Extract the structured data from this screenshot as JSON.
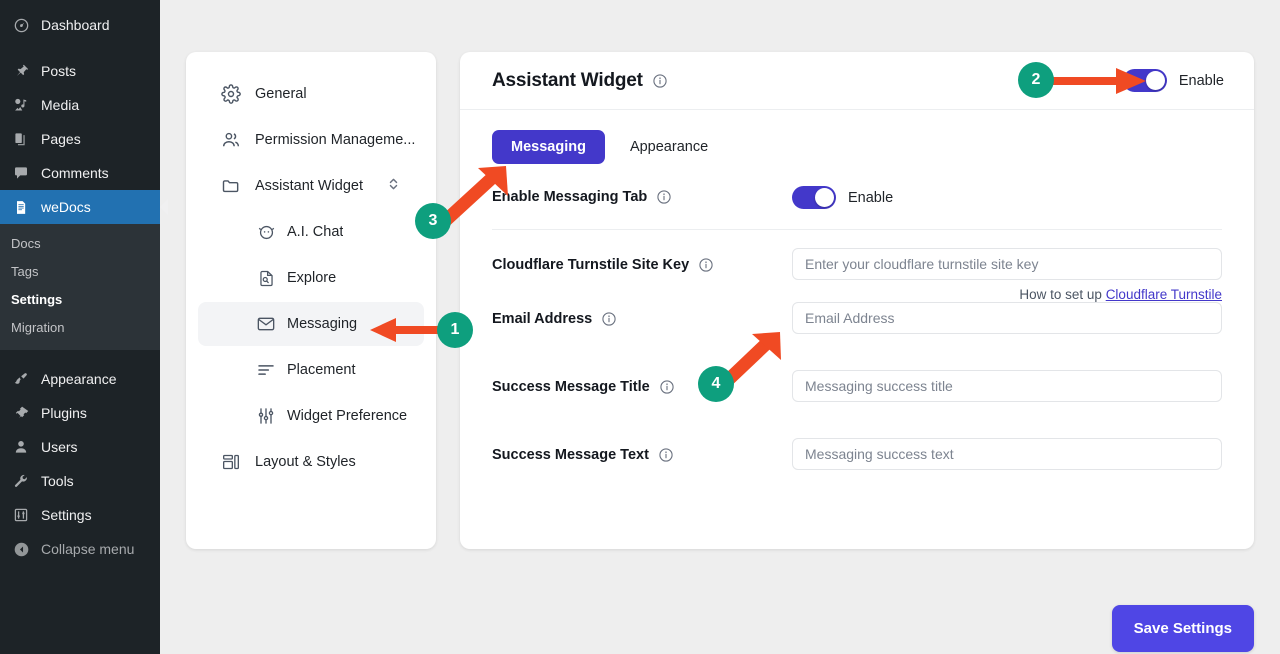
{
  "wp_admin": {
    "items": [
      {
        "label": "Dashboard",
        "icon": "dashboard-icon"
      },
      {
        "label": "Posts",
        "icon": "pin-icon"
      },
      {
        "label": "Media",
        "icon": "media-icon"
      },
      {
        "label": "Pages",
        "icon": "pages-icon"
      },
      {
        "label": "Comments",
        "icon": "comments-icon"
      },
      {
        "label": "weDocs",
        "icon": "document-icon",
        "active": true
      }
    ],
    "submenu": [
      {
        "label": "Docs",
        "current": false
      },
      {
        "label": "Tags",
        "current": false
      },
      {
        "label": "Settings",
        "current": true
      },
      {
        "label": "Migration",
        "current": false
      }
    ],
    "items_bottom": [
      {
        "label": "Appearance",
        "icon": "brush-icon"
      },
      {
        "label": "Plugins",
        "icon": "plug-icon"
      },
      {
        "label": "Users",
        "icon": "user-icon"
      },
      {
        "label": "Tools",
        "icon": "wrench-icon"
      },
      {
        "label": "Settings",
        "icon": "sliders-icon"
      }
    ],
    "collapse_label": "Collapse menu"
  },
  "settings_nav": {
    "items": [
      {
        "label": "General",
        "icon": "gear-icon",
        "level": "top",
        "selected": false
      },
      {
        "label": "Permission Manageme...",
        "icon": "people-icon",
        "level": "top",
        "selected": false
      },
      {
        "label": "Assistant Widget",
        "icon": "folder-icon",
        "level": "top",
        "selected": false,
        "chevrons": true
      },
      {
        "label": "A.I. Chat",
        "icon": "ai-chat-icon",
        "level": "sub",
        "selected": false
      },
      {
        "label": "Explore",
        "icon": "explore-icon",
        "level": "sub",
        "selected": false
      },
      {
        "label": "Messaging",
        "icon": "mail-icon",
        "level": "sub",
        "selected": true
      },
      {
        "label": "Placement",
        "icon": "placement-icon",
        "level": "sub",
        "selected": false
      },
      {
        "label": "Widget Preference",
        "icon": "sliders-icon",
        "level": "sub",
        "selected": false
      },
      {
        "label": "Layout & Styles",
        "icon": "layout-icon",
        "level": "top",
        "selected": false
      }
    ]
  },
  "main": {
    "title": "Assistant Widget",
    "header_toggle": {
      "label": "Enable",
      "on": true
    },
    "tabs": [
      {
        "label": "Messaging",
        "active": true
      },
      {
        "label": "Appearance",
        "active": false
      }
    ],
    "fields": {
      "enable_messaging_tab": {
        "label": "Enable Messaging Tab",
        "toggle_label": "Enable",
        "on": true
      },
      "turnstile_site_key": {
        "label": "Cloudflare Turnstile Site Key",
        "placeholder": "Enter your cloudflare turnstile site key",
        "value": "",
        "help_prefix": "How to set up ",
        "help_link": "Cloudflare Turnstile"
      },
      "email_address": {
        "label": "Email Address",
        "placeholder": "Email Address",
        "value": ""
      },
      "success_message_title": {
        "label": "Success Message Title",
        "placeholder": "Messaging success title",
        "value": ""
      },
      "success_message_text": {
        "label": "Success Message Text",
        "placeholder": "Messaging success text",
        "value": ""
      }
    },
    "save_label": "Save Settings"
  },
  "annotations": {
    "markers": [
      {
        "number": "1",
        "target": "messaging-nav-item"
      },
      {
        "number": "2",
        "target": "header-enable-toggle"
      },
      {
        "number": "3",
        "target": "messaging-tab"
      },
      {
        "number": "4",
        "target": "email-address-input"
      }
    ],
    "arrow_color": "#f04a23",
    "badge_color": "#0e9f7e"
  },
  "colors": {
    "accent": "#4338ca",
    "save_button": "#4f46e5",
    "wp_sidebar": "#1d2327",
    "wp_active": "#2271b1",
    "page_bg": "#eeeeee"
  }
}
